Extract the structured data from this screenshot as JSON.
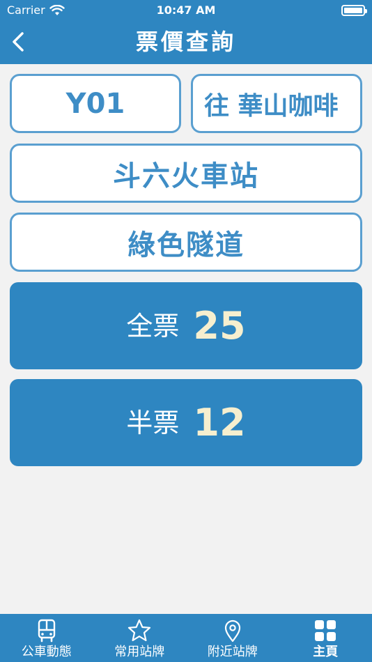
{
  "status_bar": {
    "carrier": "Carrier",
    "time": "10:47 AM"
  },
  "header": {
    "title": "票價查詢",
    "back_icon": "chevron-left-icon"
  },
  "selectors": {
    "route": "Y01",
    "direction": "往 華山咖啡",
    "from_stop": "斗六火車站",
    "to_stop": "綠色隧道"
  },
  "fares": {
    "full": {
      "label": "全票",
      "value": "25"
    },
    "half": {
      "label": "半票",
      "value": "12"
    }
  },
  "tabbar": {
    "items": [
      {
        "label": "公車動態",
        "icon": "bus-icon"
      },
      {
        "label": "常用站牌",
        "icon": "star-icon"
      },
      {
        "label": "附近站牌",
        "icon": "location-pin-icon"
      },
      {
        "label": "主頁",
        "icon": "grid-icon",
        "active": true
      }
    ]
  },
  "colors": {
    "primary": "#2e86c1",
    "box_border": "#5a9fd0",
    "box_text": "#3e8dc6",
    "fare_value": "#f6efcf",
    "background": "#f2f2f2"
  }
}
